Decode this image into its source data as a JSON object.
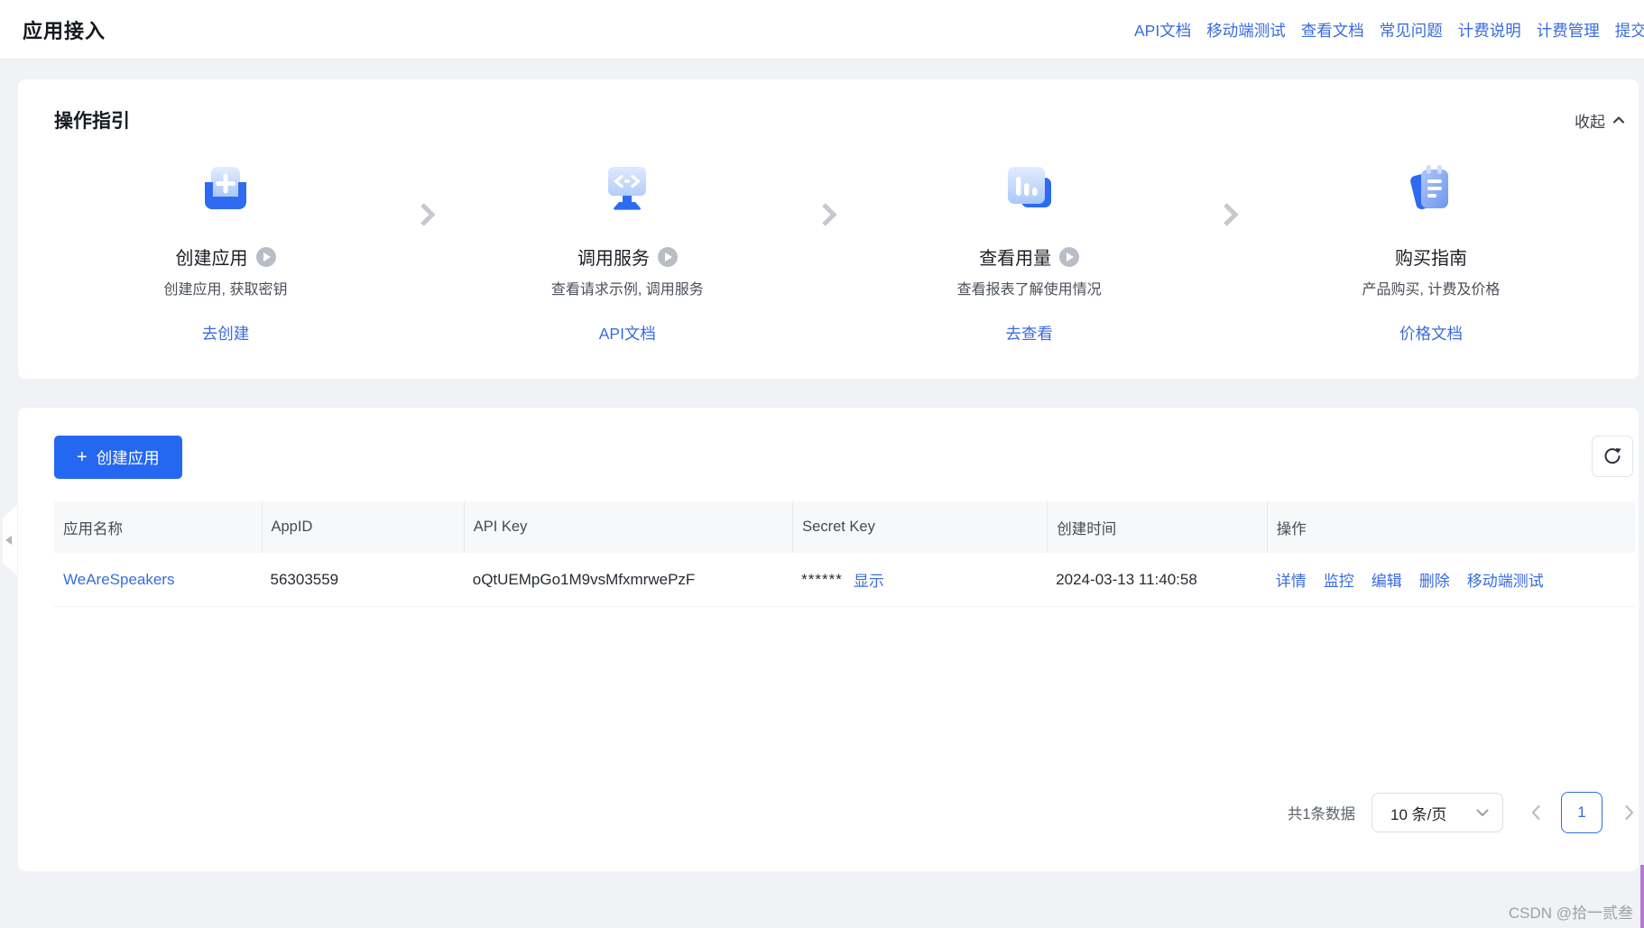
{
  "colors": {
    "accent_link": "#3a6be0",
    "primary_button": "#2468f2",
    "page_bg": "#f1f2f5",
    "icon_blue": "#2e6bf2"
  },
  "header": {
    "title": "应用接入",
    "links": [
      "API文档",
      "移动端测试",
      "查看文档",
      "常见问题",
      "计费说明",
      "计费管理",
      "提交工单"
    ]
  },
  "guide": {
    "title": "操作指引",
    "collapse": "收起",
    "steps": [
      {
        "title": "创建应用",
        "desc": "创建应用, 获取密钥",
        "link": "去创建"
      },
      {
        "title": "调用服务",
        "desc": "查看请求示例, 调用服务",
        "link": "API文档"
      },
      {
        "title": "查看用量",
        "desc": "查看报表了解使用情况",
        "link": "去查看"
      },
      {
        "title": "购买指南",
        "desc": "产品购买, 计费及价格",
        "link": "价格文档"
      }
    ]
  },
  "apps": {
    "create_button": "创建应用",
    "columns": [
      "应用名称",
      "AppID",
      "API Key",
      "Secret Key",
      "创建时间",
      "操作"
    ],
    "rows": [
      {
        "name": "WeAreSpeakers",
        "appid": "56303559",
        "api_key": "oQtUEMpGo1M9vsMfxmrwePzF",
        "secret_mask": "******",
        "secret_toggle": "显示",
        "created": "2024-03-13 11:40:58",
        "actions": [
          "详情",
          "监控",
          "编辑",
          "删除",
          "移动端测试"
        ]
      }
    ],
    "pagination": {
      "total": "共1条数据",
      "page_size": "10 条/页",
      "page": "1"
    }
  },
  "watermark": "CSDN @拾一贰叁"
}
